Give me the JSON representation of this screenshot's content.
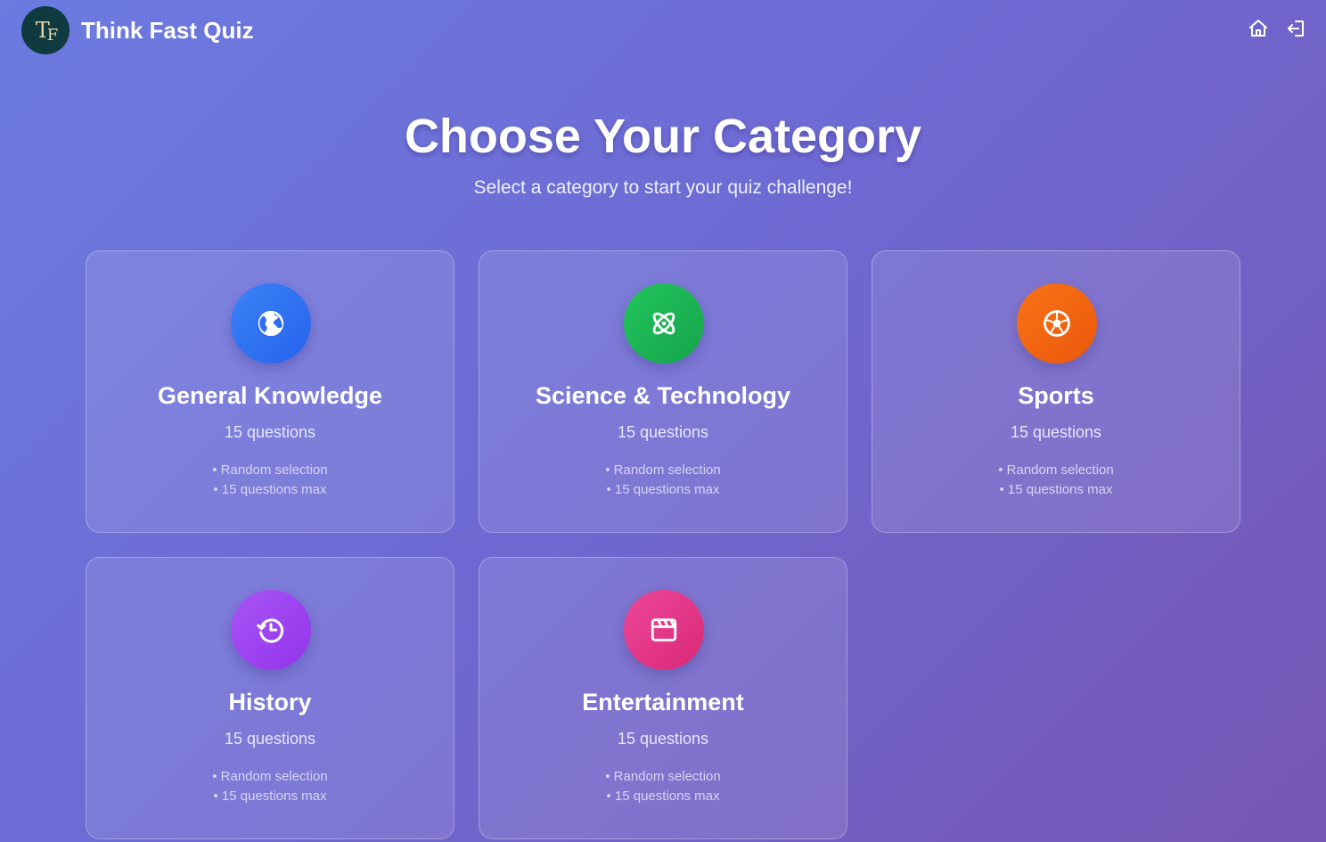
{
  "header": {
    "logo_text": "TF",
    "brand": "Think Fast Quiz",
    "icons": [
      "home-icon",
      "logout-icon"
    ]
  },
  "hero": {
    "title": "Choose Your Category",
    "subtitle": "Select a category to start your quiz challenge!"
  },
  "categories": [
    {
      "title": "General Knowledge",
      "count": "15 questions",
      "features": [
        "• Random selection",
        "• 15 questions max"
      ],
      "icon": "globe-icon",
      "color": "#3b82f6"
    },
    {
      "title": "Science & Technology",
      "count": "15 questions",
      "features": [
        "• Random selection",
        "• 15 questions max"
      ],
      "icon": "atom-icon",
      "color": "#22c55e"
    },
    {
      "title": "Sports",
      "count": "15 questions",
      "features": [
        "• Random selection",
        "• 15 questions max"
      ],
      "icon": "soccer-ball-icon",
      "color": "#f97316"
    },
    {
      "title": "History",
      "count": "15 questions",
      "features": [
        "• Random selection",
        "• 15 questions max"
      ],
      "icon": "history-clock-icon",
      "color": "#a855f7"
    },
    {
      "title": "Entertainment",
      "count": "15 questions",
      "features": [
        "• Random selection",
        "• 15 questions max"
      ],
      "icon": "clapperboard-icon",
      "color": "#ec4899"
    }
  ]
}
